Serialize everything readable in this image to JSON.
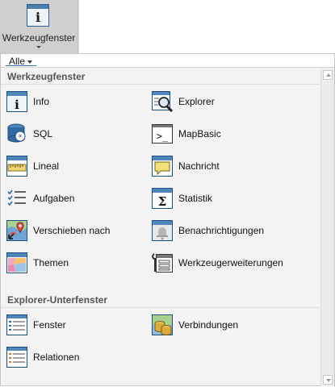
{
  "ribbon": {
    "button_label": "Werkzeugfenster",
    "button_icon": "info-window-icon",
    "glyph": "i"
  },
  "filter": {
    "label": "Alle"
  },
  "sections": [
    {
      "title": "Werkzeugfenster",
      "items": [
        {
          "label": "Info",
          "icon": "info-icon",
          "glyph": "i"
        },
        {
          "label": "Explorer",
          "icon": "explorer-magnifier-icon"
        },
        {
          "label": "SQL",
          "icon": "sql-database-icon"
        },
        {
          "label": "MapBasic",
          "icon": "console-prompt-icon",
          "glyph": ">_"
        },
        {
          "label": "Lineal",
          "icon": "ruler-icon"
        },
        {
          "label": "Nachricht",
          "icon": "speech-bubble-icon"
        },
        {
          "label": "Aufgaben",
          "icon": "checklist-icon"
        },
        {
          "label": "Statistik",
          "icon": "sigma-icon",
          "glyph": "Σ"
        },
        {
          "label": "Verschieben nach",
          "icon": "move-to-map-icon"
        },
        {
          "label": "Benachrichtigungen",
          "icon": "bell-icon"
        },
        {
          "label": "Themen",
          "icon": "thematic-map-icon"
        },
        {
          "label": "Werkzeugerweiterungen",
          "icon": "tool-extensions-icon"
        }
      ]
    },
    {
      "title": "Explorer-Unterfenster",
      "items": [
        {
          "label": "Fenster",
          "icon": "window-list-icon"
        },
        {
          "label": "Verbindungen",
          "icon": "database-connections-icon"
        },
        {
          "label": "Relationen",
          "icon": "relations-list-icon"
        }
      ]
    }
  ],
  "colors": {
    "accent": "#2a6fbf",
    "icon_border": "#1d4f7e",
    "icon_fill": "#e9f0f7",
    "panel_bg": "#f3f3f3"
  }
}
